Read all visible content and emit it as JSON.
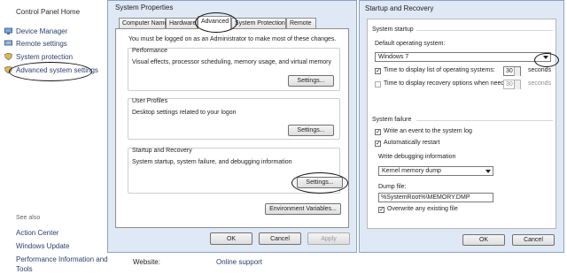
{
  "control_panel": {
    "home": "Control Panel Home",
    "links": [
      "Device Manager",
      "Remote settings",
      "System protection",
      "Advanced system settings"
    ],
    "see_also": {
      "title": "See also",
      "links": [
        "Action Center",
        "Windows Update",
        "Performance Information and",
        "Tools"
      ]
    }
  },
  "system_properties": {
    "title": "System Properties",
    "tabs": [
      "Computer Name",
      "Hardware",
      "Advanced",
      "System Protection",
      "Remote"
    ],
    "active_tab": "Advanced",
    "admin_note": "You must be logged on as an Administrator to make most of these changes.",
    "groups": {
      "performance": {
        "title": "Performance",
        "desc": "Visual effects, processor scheduling, memory usage, and virtual memory",
        "button": "Settings..."
      },
      "user_profiles": {
        "title": "User Profiles",
        "desc": "Desktop settings related to your logon",
        "button": "Settings..."
      },
      "startup": {
        "title": "Startup and Recovery",
        "desc": "System startup, system failure, and debugging information",
        "button": "Settings..."
      }
    },
    "env_button": "Environment Variables...",
    "ok": "OK",
    "cancel": "Cancel",
    "apply": "Apply"
  },
  "startup_recovery": {
    "title": "Startup and Recovery",
    "system_startup": "System startup",
    "default_os_label": "Default operating system:",
    "default_os_value": "Windows 7",
    "time_list_label": "Time to display list of operating systems:",
    "time_list_value": "30",
    "time_list_checked": true,
    "time_recovery_label": "Time to display recovery options when needed:",
    "time_recovery_value": "30",
    "time_recovery_checked": false,
    "seconds": "seconds",
    "system_failure": "System failure",
    "write_event_label": "Write an event to the system log",
    "auto_restart_label": "Automatically restart",
    "debug_section": "Write debugging information",
    "debug_value": "Kernel memory dump",
    "dump_file_label": "Dump file:",
    "dump_file_value": "%SystemRoot%\\MEMORY.DMP",
    "overwrite_label": "Overwrite any existing file",
    "ok": "OK",
    "cancel": "Cancel"
  },
  "footer": {
    "website_label": "Website:",
    "online_support": "Online support"
  }
}
